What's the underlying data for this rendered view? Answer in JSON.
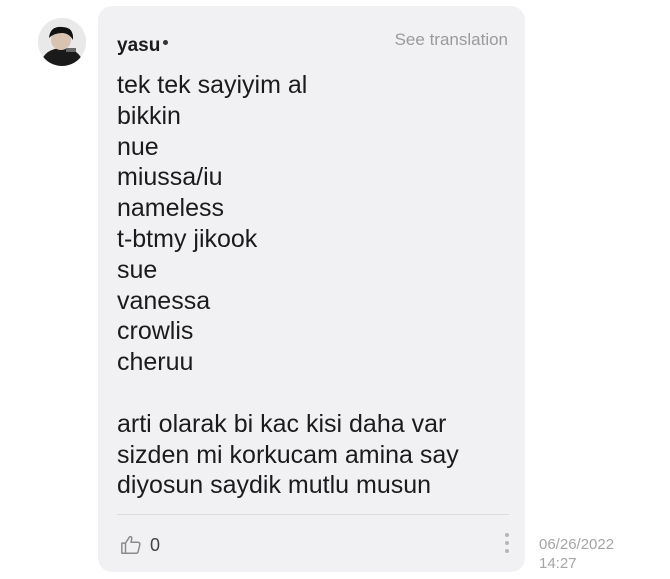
{
  "comment": {
    "username": "yasu",
    "see_translation": "See translation",
    "lines": [
      "tek tek sayiyim al",
      "bikkin",
      "nue",
      "miussa/iu",
      "nameless",
      "t-btmy jikook",
      "sue",
      "vanessa",
      "crowlis",
      "cheruu"
    ],
    "lines2": [
      "arti olarak bi kac kisi daha var",
      "sizden mi korkucam amina say",
      "diyosun saydik mutlu musun"
    ],
    "like_count": "0",
    "date": "06/26/2022",
    "time": "14:27"
  },
  "icons": {
    "avatar": "user-avatar",
    "like": "thumbs-up-icon",
    "more": "more-vertical-icon"
  },
  "colors": {
    "bubble": "#f1f1f4",
    "text": "#1b1b1b",
    "muted": "#9a9a9a"
  }
}
